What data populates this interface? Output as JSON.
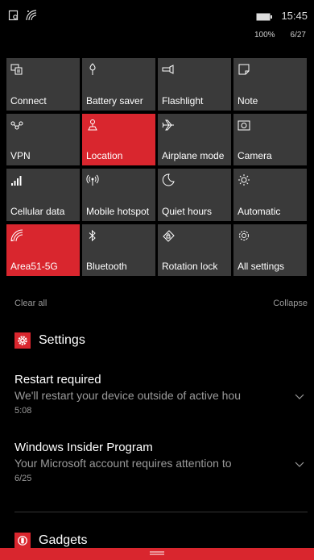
{
  "status_bar": {
    "time": "15:45",
    "battery_percent": "100%",
    "date": "6/27"
  },
  "quick_actions": [
    {
      "label": "Connect",
      "icon": "connect-icon",
      "active": false
    },
    {
      "label": "Battery saver",
      "icon": "battery-saver-icon",
      "active": false
    },
    {
      "label": "Flashlight",
      "icon": "flashlight-icon",
      "active": false
    },
    {
      "label": "Note",
      "icon": "note-icon",
      "active": false
    },
    {
      "label": "VPN",
      "icon": "vpn-icon",
      "active": false
    },
    {
      "label": "Location",
      "icon": "location-icon",
      "active": true
    },
    {
      "label": "Airplane mode",
      "icon": "airplane-icon",
      "active": false
    },
    {
      "label": "Camera",
      "icon": "camera-icon",
      "active": false
    },
    {
      "label": "Cellular data",
      "icon": "cellular-icon",
      "active": false
    },
    {
      "label": "Mobile hotspot",
      "icon": "hotspot-icon",
      "active": false
    },
    {
      "label": "Quiet hours",
      "icon": "moon-icon",
      "active": false
    },
    {
      "label": "Automatic",
      "icon": "brightness-icon",
      "active": false
    },
    {
      "label": "Area51-5G",
      "icon": "wifi-icon",
      "active": true
    },
    {
      "label": "Bluetooth",
      "icon": "bluetooth-icon",
      "active": false
    },
    {
      "label": "Rotation lock",
      "icon": "rotation-lock-icon",
      "active": false
    },
    {
      "label": "All settings",
      "icon": "gear-icon",
      "active": false
    }
  ],
  "actions": {
    "clear_all": "Clear all",
    "collapse": "Collapse"
  },
  "groups": [
    {
      "app": "Settings",
      "icon": "settings-gear-icon",
      "notifications": [
        {
          "title": "Restart required",
          "body": "We'll restart your device outside of active hou",
          "time": "5:08"
        },
        {
          "title": "Windows Insider Program",
          "body": "Your Microsoft account requires attention to",
          "time": "6/25"
        }
      ]
    },
    {
      "app": "Gadgets",
      "icon": "gadgets-icon",
      "notifications": []
    }
  ],
  "colors": {
    "accent": "#d9262e",
    "tile_bg": "#3a3a3a",
    "background": "#000000",
    "secondary_text": "#9a9a9a"
  }
}
